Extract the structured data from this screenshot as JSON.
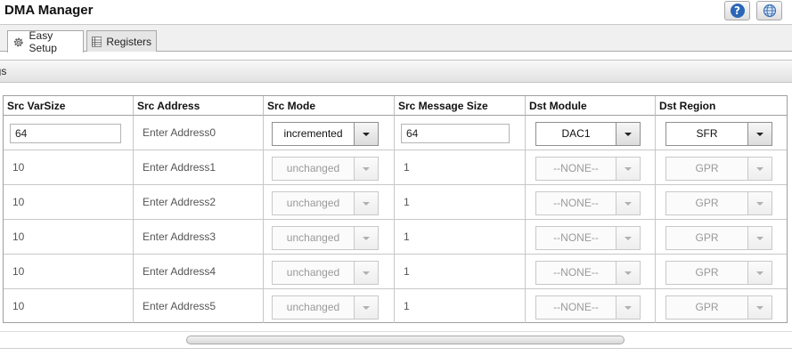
{
  "window": {
    "title": "DMA Manager"
  },
  "icons": {
    "help": "help-icon",
    "globe": "globe-icon",
    "gear": "gear-icon",
    "registers": "registers-table-icon"
  },
  "help_label": "?",
  "tabs": [
    {
      "label": "Easy Setup",
      "active": true
    },
    {
      "label": "Registers",
      "active": false
    }
  ],
  "section": {
    "title": "ngs"
  },
  "grid": {
    "headers": [
      "Src VarSize",
      "Src Address",
      "Src Mode",
      "Src Message Size",
      "Dst Module",
      "Dst Region"
    ],
    "rows": [
      {
        "src_varsize": "64",
        "src_address": "Enter Address0",
        "src_mode": "incremented",
        "src_message_size": "64",
        "dst_module": "DAC1",
        "dst_region": "SFR",
        "enabled": true
      },
      {
        "src_varsize": "10",
        "src_address": "Enter Address1",
        "src_mode": "unchanged",
        "src_message_size": "1",
        "dst_module": "--NONE--",
        "dst_region": "GPR",
        "enabled": false
      },
      {
        "src_varsize": "10",
        "src_address": "Enter Address2",
        "src_mode": "unchanged",
        "src_message_size": "1",
        "dst_module": "--NONE--",
        "dst_region": "GPR",
        "enabled": false
      },
      {
        "src_varsize": "10",
        "src_address": "Enter Address3",
        "src_mode": "unchanged",
        "src_message_size": "1",
        "dst_module": "--NONE--",
        "dst_region": "GPR",
        "enabled": false
      },
      {
        "src_varsize": "10",
        "src_address": "Enter Address4",
        "src_mode": "unchanged",
        "src_message_size": "1",
        "dst_module": "--NONE--",
        "dst_region": "GPR",
        "enabled": false
      },
      {
        "src_varsize": "10",
        "src_address": "Enter Address5",
        "src_mode": "unchanged",
        "src_message_size": "1",
        "dst_module": "--NONE--",
        "dst_region": "GPR",
        "enabled": false
      }
    ]
  },
  "colors": {
    "help_blue": "#2a66b8",
    "border": "#a0a0a0",
    "disabled_text": "#9a9a9a"
  }
}
